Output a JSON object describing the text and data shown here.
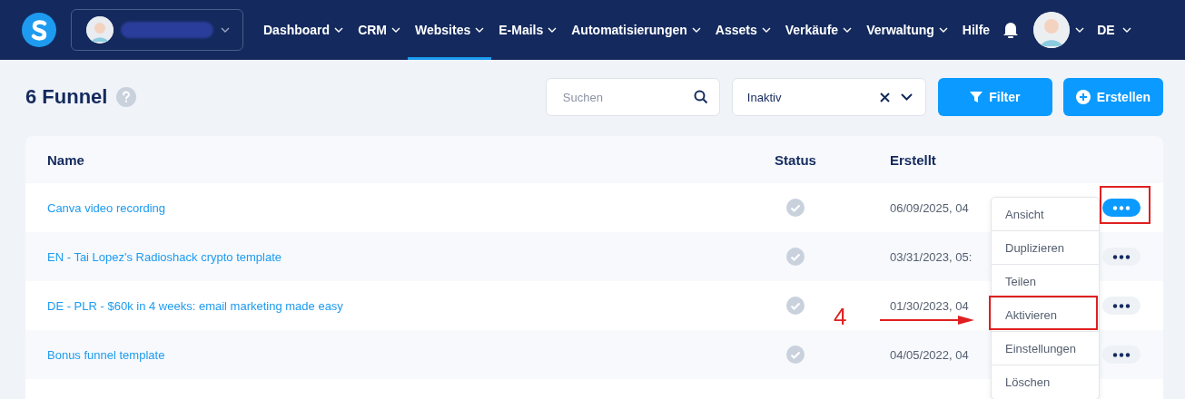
{
  "nav": {
    "items": [
      {
        "label": "Dashboard",
        "dropdown": true,
        "selected": false
      },
      {
        "label": "CRM",
        "dropdown": true,
        "selected": false
      },
      {
        "label": "Websites",
        "dropdown": true,
        "selected": true
      },
      {
        "label": "E-Mails",
        "dropdown": true,
        "selected": false
      },
      {
        "label": "Automatisierungen",
        "dropdown": true,
        "selected": false
      },
      {
        "label": "Assets",
        "dropdown": true,
        "selected": false
      },
      {
        "label": "Verkäufe",
        "dropdown": true,
        "selected": false
      },
      {
        "label": "Verwaltung",
        "dropdown": true,
        "selected": false
      },
      {
        "label": "Hilfe",
        "dropdown": false,
        "selected": false
      }
    ],
    "language": "DE"
  },
  "page": {
    "title": "6 Funnel"
  },
  "search": {
    "placeholder": "Suchen"
  },
  "status_filter": {
    "value": "Inaktiv"
  },
  "buttons": [
    {
      "label": "Filter",
      "kind": "filter"
    },
    {
      "label": "Erstellen",
      "kind": "create"
    }
  ],
  "table": {
    "columns": [
      "Name",
      "Status",
      "Erstellt"
    ],
    "rows": [
      {
        "name": "Canva video recording",
        "created": "06/09/2025, 04",
        "menu_open": true
      },
      {
        "name": "EN - Tai Lopez's Radioshack crypto template",
        "created": "03/31/2023, 05:",
        "menu_open": false
      },
      {
        "name": "DE - PLR - $60k in 4 weeks: email marketing made easy",
        "created": "01/30/2023, 04",
        "menu_open": false
      },
      {
        "name": "Bonus funnel template",
        "created": "04/05/2022, 04",
        "menu_open": false
      }
    ]
  },
  "context_menu": {
    "items": [
      {
        "label": "Ansicht",
        "highlighted": false
      },
      {
        "label": "Duplizieren",
        "highlighted": false
      },
      {
        "label": "Teilen",
        "highlighted": false
      },
      {
        "label": "Aktivieren",
        "highlighted": true
      },
      {
        "label": "Einstellungen",
        "highlighted": false
      },
      {
        "label": "Löschen",
        "highlighted": false
      }
    ]
  },
  "annotation": {
    "label": "4"
  }
}
